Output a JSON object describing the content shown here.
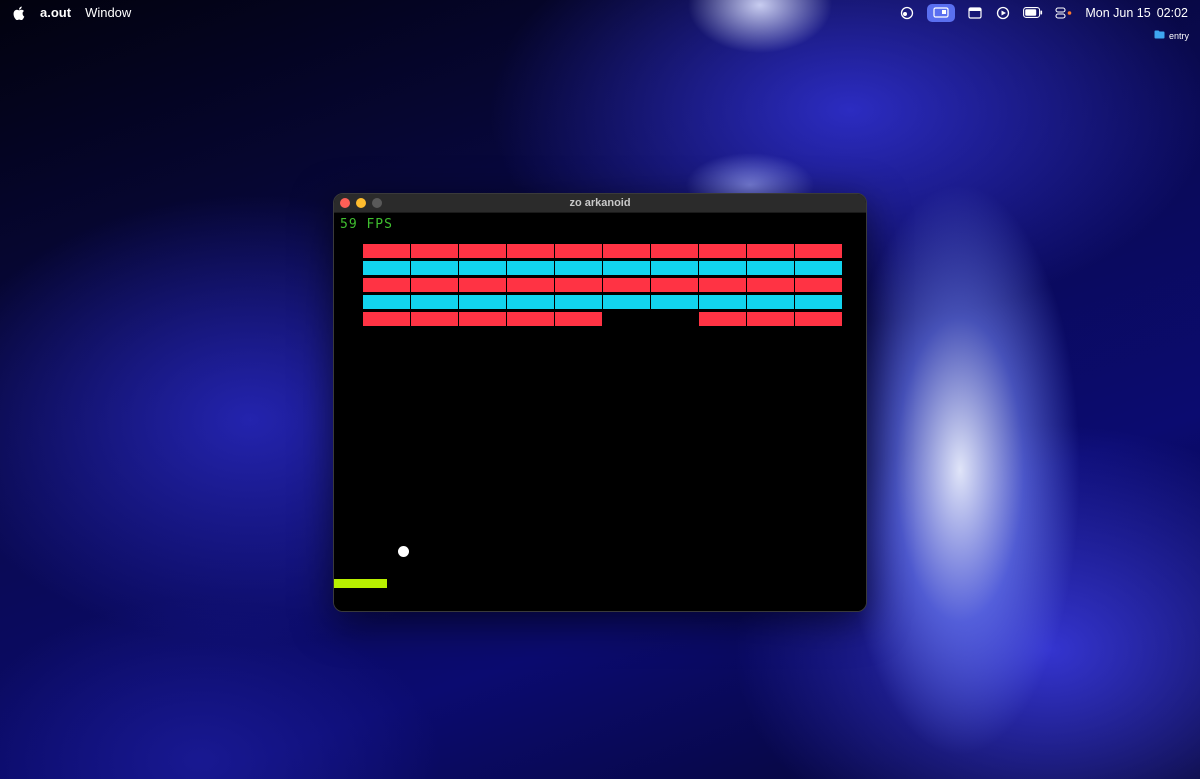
{
  "menubar": {
    "app_name": "a.out",
    "menus": [
      "Window"
    ],
    "status_icons": [
      "screen-share-icon",
      "display-pill-icon",
      "window-icon",
      "play-icon",
      "battery-icon",
      "control-center-icon"
    ],
    "clock": {
      "date": "Mon Jun 15",
      "time": "02:02"
    }
  },
  "desktop": {
    "items": [
      {
        "label": "entry",
        "icon": "folder-icon"
      }
    ]
  },
  "window": {
    "title": "zo arkanoid",
    "traffic_lights": {
      "close": "#ff5f57",
      "minimize": "#febc2e",
      "maximize": "#595959"
    }
  },
  "game": {
    "fps_label": "59 FPS",
    "colors": {
      "red": "#ff3344",
      "cyan": "#12d4ef",
      "paddle": "#b8f000",
      "ball": "#ffffff",
      "fps": "#3fbf2f"
    },
    "columns": 10,
    "rows": [
      {
        "color": "red",
        "bricks": [
          1,
          1,
          1,
          1,
          1,
          1,
          1,
          1,
          1,
          1
        ]
      },
      {
        "color": "cyan",
        "bricks": [
          1,
          1,
          1,
          1,
          1,
          1,
          1,
          1,
          1,
          1
        ]
      },
      {
        "color": "red",
        "bricks": [
          1,
          1,
          1,
          1,
          1,
          1,
          1,
          1,
          1,
          1
        ]
      },
      {
        "color": "cyan",
        "bricks": [
          1,
          1,
          1,
          1,
          1,
          1,
          1,
          1,
          1,
          1
        ]
      },
      {
        "color": "red",
        "bricks": [
          1,
          1,
          1,
          1,
          1,
          0,
          0,
          1,
          1,
          1
        ]
      }
    ]
  }
}
